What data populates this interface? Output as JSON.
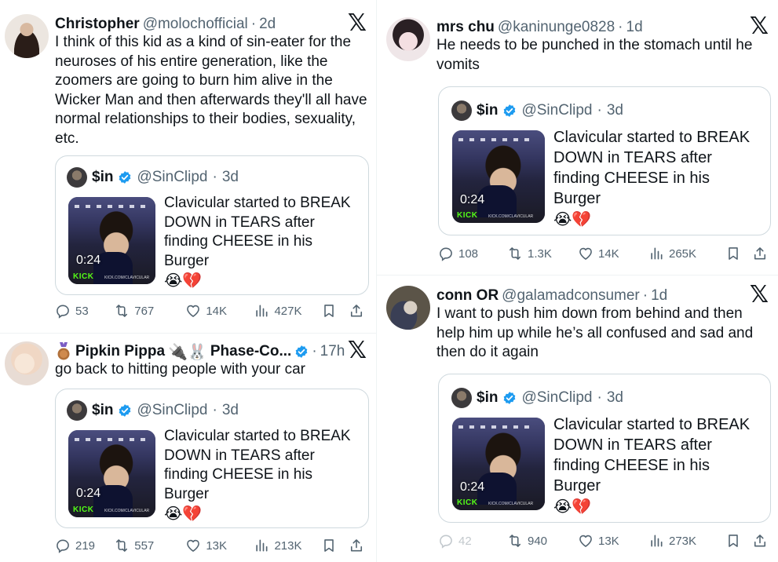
{
  "quoted": {
    "name": "$in",
    "handle": "@SinClipd",
    "time": "3d",
    "text": "Clavicular started to BREAK DOWN in TEARS after finding CHEESE in his Burger",
    "emoji": "😭💔",
    "duration": "0:24",
    "watermark": "KICK",
    "watermark_url": "KICK.COM/CLAVICULAR"
  },
  "tweets": [
    {
      "name": "Christopher",
      "handle": "@molochofficial",
      "time": "2d",
      "text": "I think of this kid as a kind of sin-eater for the neuroses of his entire generation, like the zoomers are going to burn him alive in the Wicker Man and then afterwards they'll all have normal relationships to their bodies, sexuality, etc.",
      "stats": {
        "replies": "53",
        "reposts": "767",
        "likes": "14K",
        "views": "427K"
      }
    },
    {
      "name": "Pipkin Pippa",
      "name_extra": "🔌🐰",
      "name_suffix": "Phase-Co...",
      "handle": "",
      "time": "17h",
      "text": "go back to hitting people with your car",
      "stats": {
        "replies": "219",
        "reposts": "557",
        "likes": "13K",
        "views": "213K"
      }
    },
    {
      "name": "mrs chu",
      "handle": "@kaninunge0828",
      "time": "1d",
      "text": "He needs to be punched in the stomach until he vomits",
      "stats": {
        "replies": "108",
        "reposts": "1.3K",
        "likes": "14K",
        "views": "265K"
      }
    },
    {
      "name": "conn OR",
      "handle": "@galamadconsumer",
      "time": "1d",
      "text": "I want to push him down from behind and then help him up while he’s all confused and sad and then do it again",
      "stats": {
        "replies": "42",
        "reposts": "940",
        "likes": "13K",
        "views": "273K"
      }
    }
  ],
  "colors": {
    "text": "#0f1419",
    "secondary": "#536471",
    "border": "#cfd9de",
    "verified": "#1d9bf0",
    "kick": "#53fc18"
  },
  "icons": [
    "x-logo-icon",
    "verified-badge-icon",
    "reply-icon",
    "repost-icon",
    "like-icon",
    "views-icon",
    "bookmark-icon",
    "share-icon",
    "medal-icon"
  ]
}
